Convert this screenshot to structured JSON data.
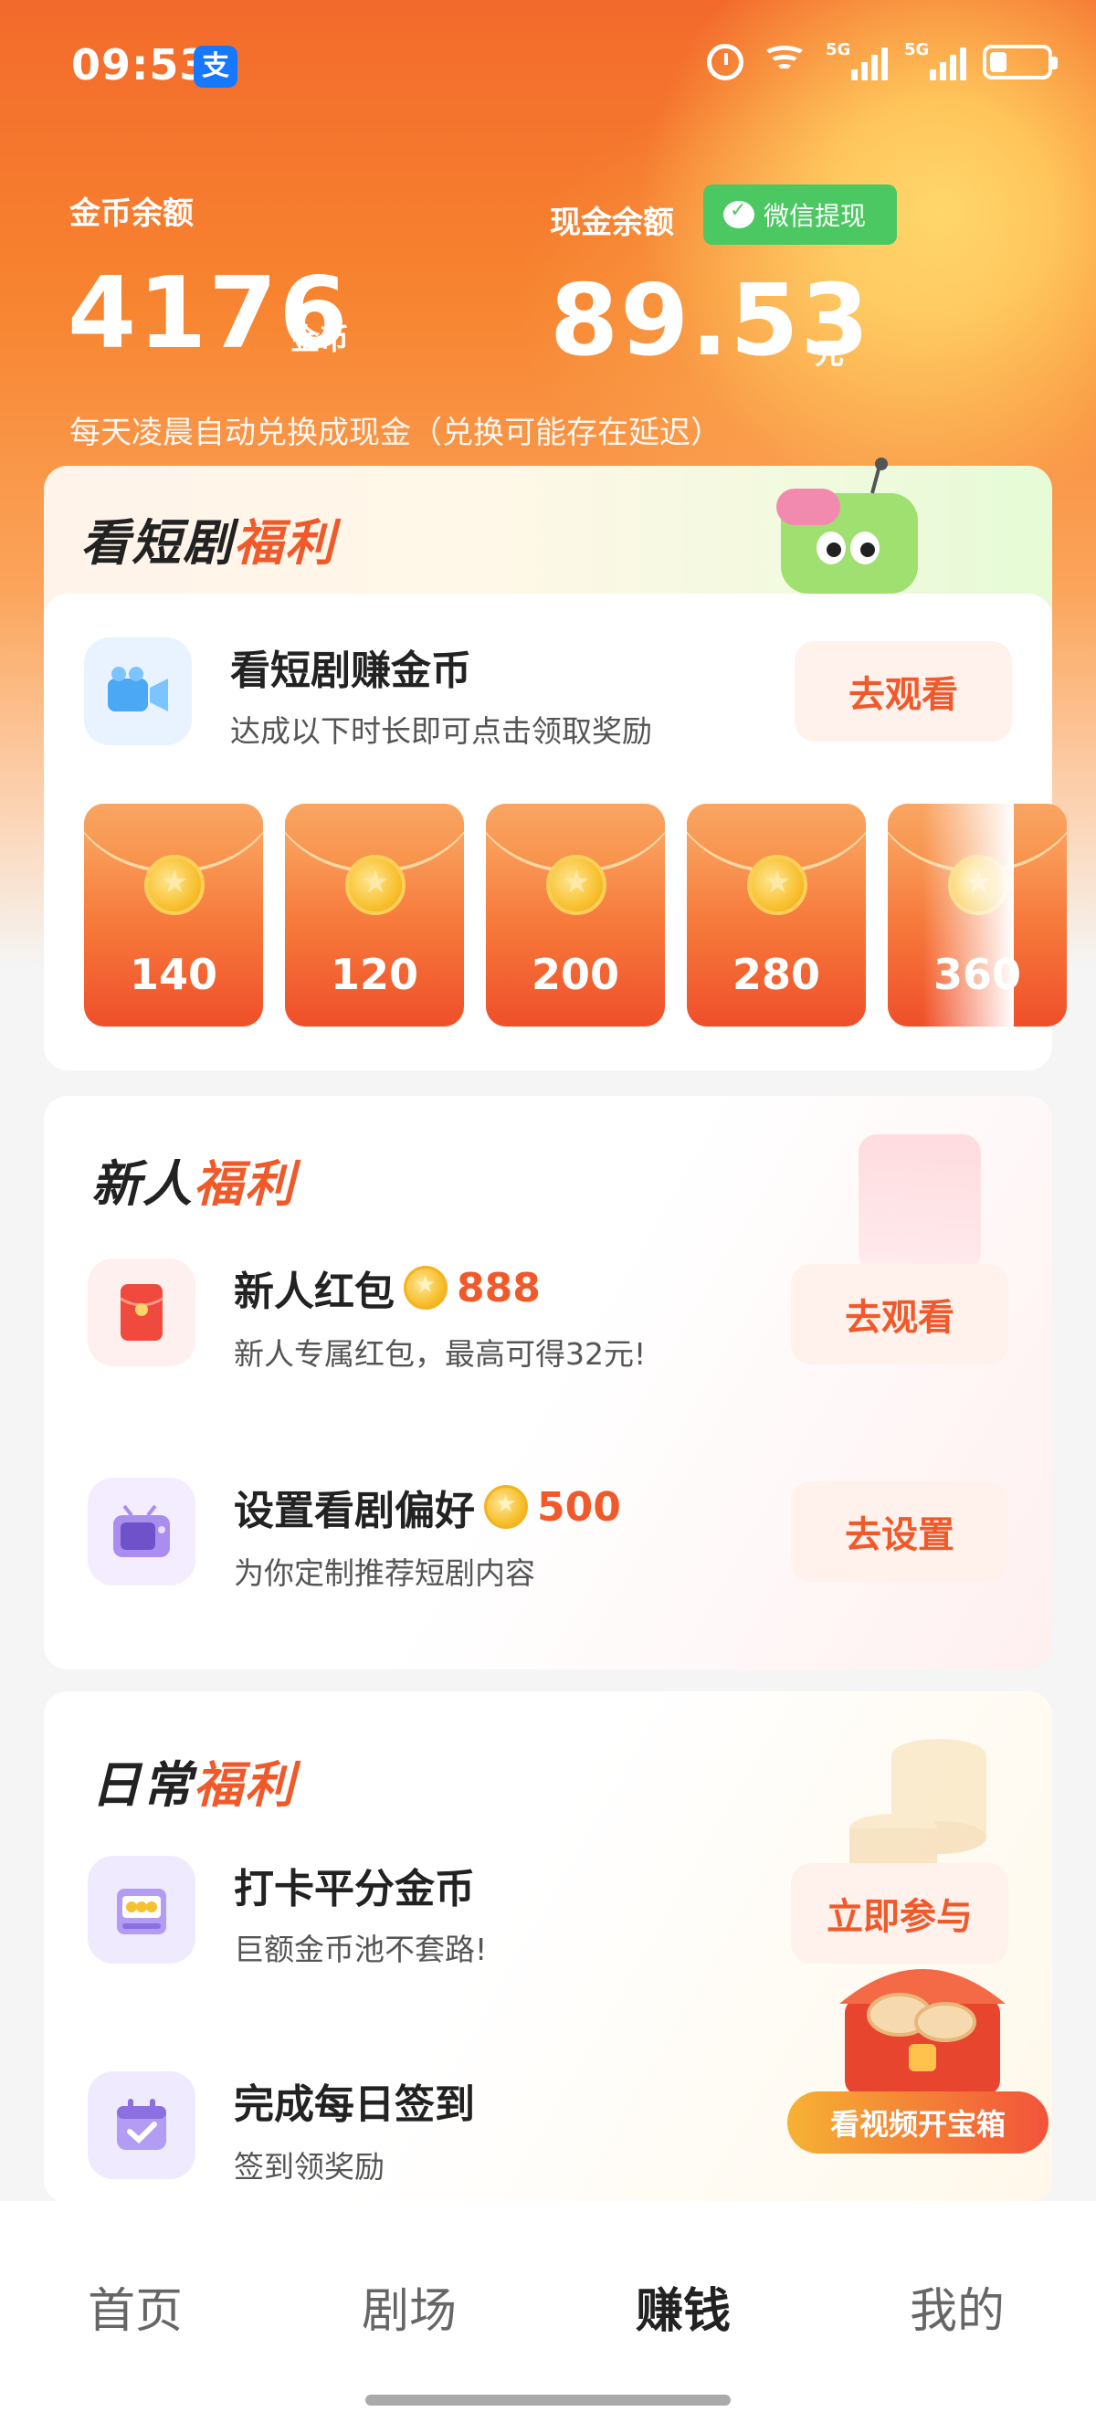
{
  "status_bar": {
    "time": "09:53",
    "app_badge": "支",
    "network_1": "5G",
    "network_2": "5G"
  },
  "balances": {
    "coin_label": "金币余额",
    "coin_value": "4176",
    "coin_unit": "金币",
    "cash_label": "现金余额",
    "cash_value": "89.53",
    "cash_unit": "元",
    "withdraw_button": "微信提现",
    "notice": "每天凌晨自动兑换成现金（兑换可能存在延迟）"
  },
  "drama_card": {
    "title_plain": "看短剧",
    "title_accent": "福利",
    "task_title": "看短剧赚金币",
    "task_sub": "达成以下时长即可点击领取奖励",
    "cta": "去观看",
    "rewards": [
      "140",
      "120",
      "200",
      "280",
      "360"
    ]
  },
  "newbie_card": {
    "title_plain": "新人",
    "title_accent": "福利",
    "items": [
      {
        "title": "新人红包",
        "coins": "888",
        "sub": "新人专属红包，最高可得32元!",
        "cta": "去观看"
      },
      {
        "title": "设置看剧偏好",
        "coins": "500",
        "sub": "为你定制推荐短剧内容",
        "cta": "去设置"
      }
    ]
  },
  "daily_card": {
    "title_plain": "日常",
    "title_accent": "福利",
    "items": [
      {
        "title": "打卡平分金币",
        "sub": "巨额金币池不套路!",
        "cta": "立即参与"
      },
      {
        "title": "完成每日签到",
        "sub": "签到领奖励"
      }
    ],
    "treasure_badge": "看视频开宝箱"
  },
  "bottom_nav": {
    "items": [
      "首页",
      "剧场",
      "赚钱",
      "我的"
    ],
    "active": "赚钱"
  },
  "colors": {
    "accent": "#f05a2b",
    "wechat_green": "#4cc863",
    "hero_orange": "#f36a2c"
  }
}
